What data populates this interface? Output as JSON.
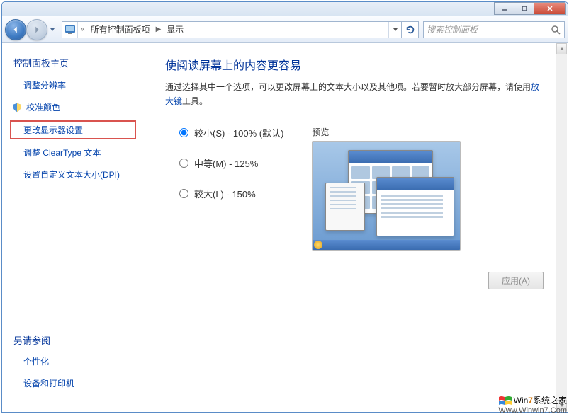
{
  "window": {
    "minimize": "–",
    "maximize": "□",
    "close": "×"
  },
  "breadcrumb": {
    "prefix": "«",
    "item1": "所有控制面板项",
    "item2": "显示"
  },
  "search": {
    "placeholder": "搜索控制面板"
  },
  "sidebar": {
    "heading": "控制面板主页",
    "items": [
      {
        "label": "调整分辨率"
      },
      {
        "label": "校准颜色"
      },
      {
        "label": "更改显示器设置"
      },
      {
        "label": "调整 ClearType 文本"
      },
      {
        "label": "设置自定义文本大小(DPI)"
      }
    ],
    "footer": {
      "heading": "另请参阅",
      "items": [
        {
          "label": "个性化"
        },
        {
          "label": "设备和打印机"
        }
      ]
    }
  },
  "main": {
    "title": "使阅读屏幕上的内容更容易",
    "desc_prefix": "通过选择其中一个选项，可以更改屏幕上的文本大小以及其他项。若要暂时放大部分屏幕，请使用",
    "desc_link": "放大镜",
    "desc_suffix": "工具。",
    "options": [
      {
        "id": "s",
        "label": "较小(S) - 100% (默认)"
      },
      {
        "id": "m",
        "label": "中等(M) - 125%"
      },
      {
        "id": "l",
        "label": "较大(L) - 150%"
      }
    ],
    "preview_label": "预览",
    "apply": "应用(A)"
  },
  "watermark": {
    "brand_prefix": "Win",
    "brand_highlight": "7",
    "brand_suffix": "系统之家",
    "url": "Www.Winwin7.Com"
  }
}
